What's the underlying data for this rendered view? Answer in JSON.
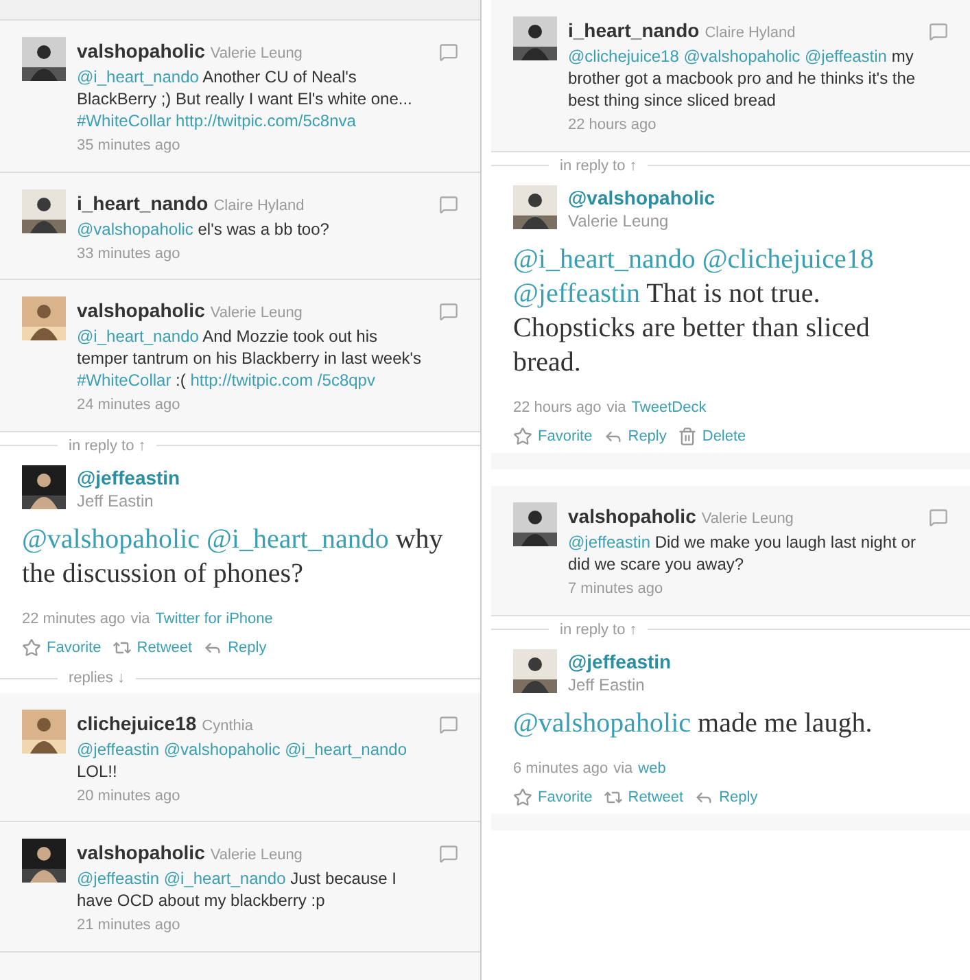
{
  "left": {
    "items": [
      {
        "kind": "tweet",
        "username": "valshopaholic",
        "full_name": "Valerie Leung",
        "segments": [
          {
            "text": "@i_heart_nando",
            "link": true
          },
          {
            "text": "Another CU of Neal's BlackBerry ;) But really I want El's white one...",
            "link": false
          },
          {
            "text": "#WhiteCollar",
            "link": true
          },
          {
            "text": "http://twitpic.com/5c8nva",
            "link": true
          }
        ],
        "time": "35 minutes ago"
      },
      {
        "kind": "tweet",
        "username": "i_heart_nando",
        "full_name": "Claire Hyland",
        "segments": [
          {
            "text": "@valshopaholic",
            "link": true
          },
          {
            "text": "el's was a bb too?",
            "link": false
          }
        ],
        "time": "33 minutes ago"
      },
      {
        "kind": "tweet",
        "username": "valshopaholic",
        "full_name": "Valerie Leung",
        "segments": [
          {
            "text": "@i_heart_nando",
            "link": true
          },
          {
            "text": "And Mozzie took out his temper tantrum on his Blackberry in last week's",
            "link": false
          },
          {
            "text": "#WhiteCollar",
            "link": true
          },
          {
            "text": ":(",
            "link": false
          },
          {
            "text": "http://twitpic.com /5c8qpv",
            "link": true
          }
        ],
        "time": "24 minutes ago"
      },
      {
        "kind": "divider",
        "label": "in reply to ↑"
      },
      {
        "kind": "focus",
        "handle": "@jeffeastin",
        "full_name": "Jeff Eastin",
        "segments": [
          {
            "text": "@valshopaholic",
            "link": true
          },
          {
            "text": "@i_heart_nando",
            "link": true
          },
          {
            "text": "why the discussion of phones?",
            "link": false
          }
        ],
        "time": "22 minutes ago",
        "via": "via",
        "source": "Twitter for iPhone",
        "actions": [
          {
            "kind": "favorite",
            "label": "Favorite"
          },
          {
            "kind": "retweet",
            "label": "Retweet"
          },
          {
            "kind": "reply",
            "label": "Reply"
          }
        ]
      },
      {
        "kind": "divider",
        "label": "replies ↓"
      },
      {
        "kind": "tweet",
        "username": "clichejuice18",
        "full_name": "Cynthia",
        "segments": [
          {
            "text": "@jeffeastin",
            "link": true
          },
          {
            "text": "@valshopaholic",
            "link": true
          },
          {
            "text": "@i_heart_nando",
            "link": true
          },
          {
            "text": "LOL!!",
            "link": false
          }
        ],
        "time": "20 minutes ago"
      },
      {
        "kind": "tweet",
        "username": "valshopaholic",
        "full_name": "Valerie Leung",
        "segments": [
          {
            "text": "@jeffeastin",
            "link": true
          },
          {
            "text": "@i_heart_nando",
            "link": true
          },
          {
            "text": "Just because I have OCD about my blackberry :p",
            "link": false
          }
        ],
        "time": "21 minutes ago"
      }
    ]
  },
  "right_top": {
    "items": [
      {
        "kind": "tweet",
        "username": "i_heart_nando",
        "full_name": "Claire Hyland",
        "segments": [
          {
            "text": "@clichejuice18",
            "link": true
          },
          {
            "text": "@valshopaholic",
            "link": true
          },
          {
            "text": "@jeffeastin",
            "link": true
          },
          {
            "text": "my brother got a macbook pro and he thinks it's the best thing since sliced bread",
            "link": false
          }
        ],
        "time": "22 hours ago"
      },
      {
        "kind": "divider",
        "label": "in reply to ↑"
      },
      {
        "kind": "focus",
        "handle": "@valshopaholic",
        "full_name": "Valerie Leung",
        "segments": [
          {
            "text": "@i_heart_nando",
            "link": true
          },
          {
            "text": "@clichejuice18",
            "link": true
          },
          {
            "text": "@jeffeastin",
            "link": true
          },
          {
            "text": "That is not true. Chopsticks are better than sliced bread.",
            "link": false
          }
        ],
        "time": "22 hours ago",
        "via": "via",
        "source": "TweetDeck",
        "actions": [
          {
            "kind": "favorite",
            "label": "Favorite"
          },
          {
            "kind": "reply",
            "label": "Reply"
          },
          {
            "kind": "delete",
            "label": "Delete"
          }
        ]
      }
    ]
  },
  "right_bottom": {
    "items": [
      {
        "kind": "tweet",
        "username": "valshopaholic",
        "full_name": "Valerie Leung",
        "segments": [
          {
            "text": "@jeffeastin",
            "link": true
          },
          {
            "text": "Did we make you laugh last night or did we scare you away?",
            "link": false
          }
        ],
        "time": "7 minutes ago"
      },
      {
        "kind": "divider",
        "label": "in reply to ↑"
      },
      {
        "kind": "focus",
        "handle": "@jeffeastin",
        "full_name": "Jeff Eastin",
        "segments": [
          {
            "text": "@valshopaholic",
            "link": true
          },
          {
            "text": "made me laugh.",
            "link": false
          }
        ],
        "time": "6 minutes ago",
        "via": "via",
        "source": "web",
        "actions": [
          {
            "kind": "favorite",
            "label": "Favorite"
          },
          {
            "kind": "retweet",
            "label": "Retweet"
          },
          {
            "kind": "reply",
            "label": "Reply"
          }
        ]
      }
    ]
  }
}
